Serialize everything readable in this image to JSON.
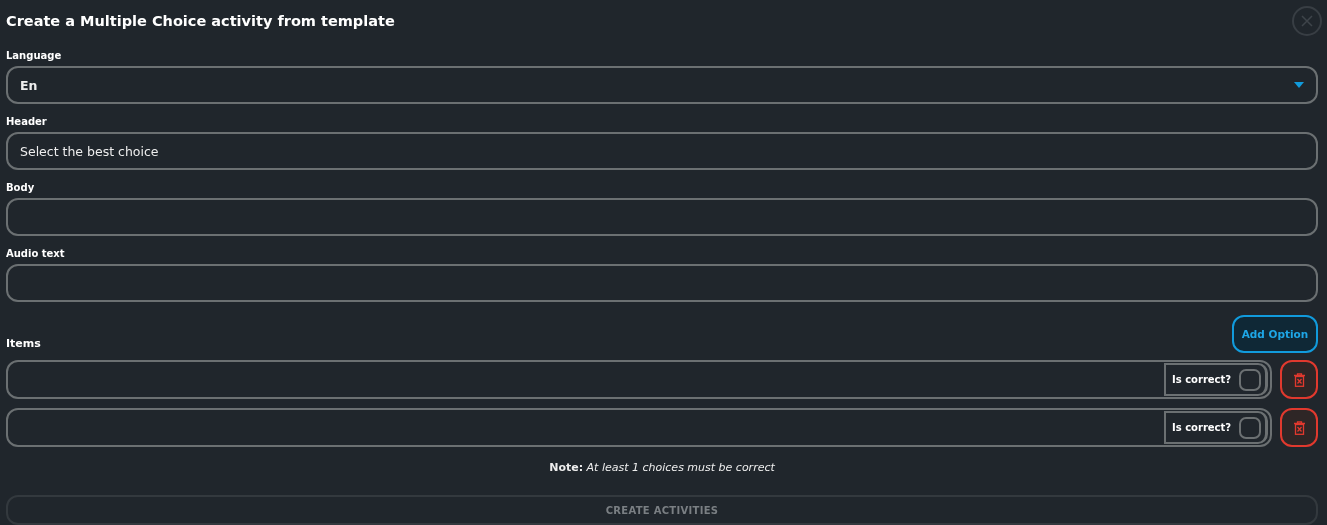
{
  "dialog": {
    "title": "Create a Multiple Choice activity from template"
  },
  "fields": [
    {
      "kind": "select",
      "label": "Language",
      "value": "En"
    },
    {
      "kind": "text",
      "label": "Header",
      "value": "Select the best choice"
    },
    {
      "kind": "text",
      "label": "Body"
    },
    {
      "kind": "text",
      "label": "Audio text"
    }
  ],
  "add_option_button": "Add Option",
  "items_label": "Items",
  "items": [
    {
      "correct_label": "Is correct?",
      "checked": false
    },
    {
      "correct_label": "Is correct?",
      "checked": false
    }
  ],
  "note": "**Note:** *At least 1 choices must be correct*",
  "create_button": {
    "label": "CREATE ACTIVITIES",
    "disabled": true
  }
}
